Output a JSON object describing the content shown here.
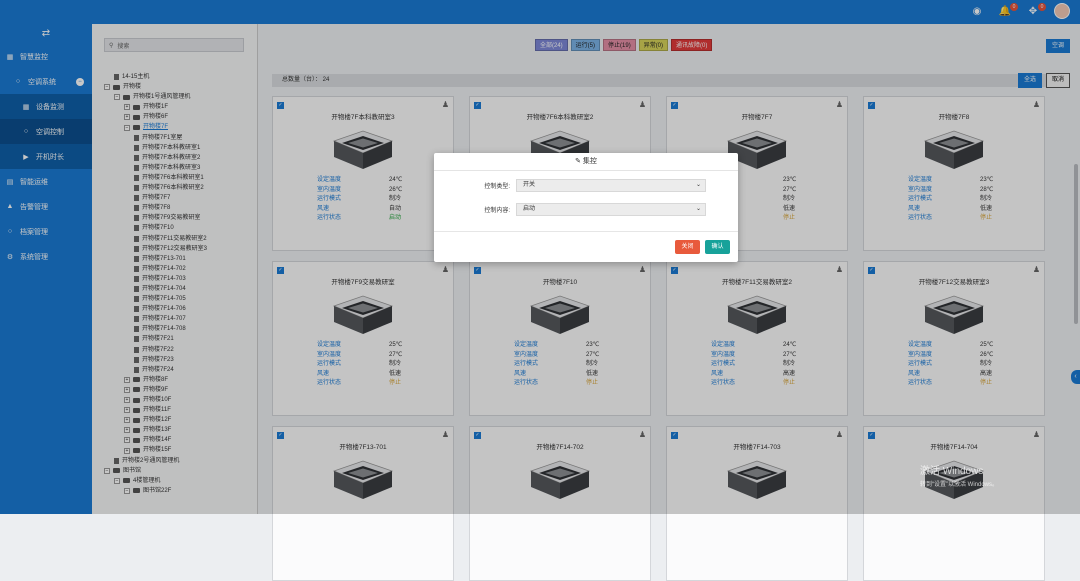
{
  "topbar": {
    "badges": {
      "bell": "0",
      "fullscreen": "0"
    },
    "icons": [
      "dashboard-icon",
      "bell-icon",
      "fullscreen-icon",
      "avatar"
    ]
  },
  "sidebar": {
    "items": [
      {
        "label": "智慧监控",
        "icon": "grid-icon",
        "level": 0
      },
      {
        "label": "空调系统",
        "icon": "circle-icon",
        "level": 1,
        "toggle": "−"
      },
      {
        "label": "设备监测",
        "icon": "grid-icon",
        "level": 2
      },
      {
        "label": "空调控制",
        "icon": "circle-icon",
        "level": 2,
        "active": true
      },
      {
        "label": "开机时长",
        "icon": "play-icon",
        "level": 2
      },
      {
        "label": "智能运维",
        "icon": "chart-icon",
        "level": 0
      },
      {
        "label": "告警管理",
        "icon": "bell-icon",
        "level": 0
      },
      {
        "label": "档案管理",
        "icon": "circle-icon",
        "level": 0
      },
      {
        "label": "系统管理",
        "icon": "gear-icon",
        "level": 0
      }
    ]
  },
  "tree": {
    "search_placeholder": "搜索",
    "nodes": [
      {
        "label": "14-15主机",
        "indent": 1,
        "type": "file"
      },
      {
        "label": "开物楼",
        "indent": 0,
        "type": "folder",
        "toggle": "−"
      },
      {
        "label": "开物楼1号通风管理机",
        "indent": 1,
        "type": "folder",
        "toggle": "−"
      },
      {
        "label": "开物楼1F",
        "indent": 2,
        "type": "folder",
        "toggle": "+"
      },
      {
        "label": "开物楼6F",
        "indent": 2,
        "type": "folder",
        "toggle": "+"
      },
      {
        "label": "开物楼7F",
        "indent": 2,
        "type": "folder",
        "toggle": "−",
        "highlight": true
      },
      {
        "label": "开物楼7F1室屋",
        "indent": 3,
        "type": "file"
      },
      {
        "label": "开物楼7F本科教研室1",
        "indent": 3,
        "type": "file"
      },
      {
        "label": "开物楼7F本科教研室2",
        "indent": 3,
        "type": "file"
      },
      {
        "label": "开物楼7F本科教研室3",
        "indent": 3,
        "type": "file"
      },
      {
        "label": "开物楼7F6本科教研室1",
        "indent": 3,
        "type": "file"
      },
      {
        "label": "开物楼7F6本科教研室2",
        "indent": 3,
        "type": "file"
      },
      {
        "label": "开物楼7F7",
        "indent": 3,
        "type": "file"
      },
      {
        "label": "开物楼7F8",
        "indent": 3,
        "type": "file"
      },
      {
        "label": "开物楼7F9交易教研室",
        "indent": 3,
        "type": "file"
      },
      {
        "label": "开物楼7F10",
        "indent": 3,
        "type": "file"
      },
      {
        "label": "开物楼7F11交易教研室2",
        "indent": 3,
        "type": "file"
      },
      {
        "label": "开物楼7F12交易教研室3",
        "indent": 3,
        "type": "file"
      },
      {
        "label": "开物楼7F13-701",
        "indent": 3,
        "type": "file"
      },
      {
        "label": "开物楼7F14-702",
        "indent": 3,
        "type": "file"
      },
      {
        "label": "开物楼7F14-703",
        "indent": 3,
        "type": "file"
      },
      {
        "label": "开物楼7F14-704",
        "indent": 3,
        "type": "file"
      },
      {
        "label": "开物楼7F14-705",
        "indent": 3,
        "type": "file"
      },
      {
        "label": "开物楼7F14-706",
        "indent": 3,
        "type": "file"
      },
      {
        "label": "开物楼7F14-707",
        "indent": 3,
        "type": "file"
      },
      {
        "label": "开物楼7F14-708",
        "indent": 3,
        "type": "file"
      },
      {
        "label": "开物楼7F21",
        "indent": 3,
        "type": "file"
      },
      {
        "label": "开物楼7F22",
        "indent": 3,
        "type": "file"
      },
      {
        "label": "开物楼7F23",
        "indent": 3,
        "type": "file"
      },
      {
        "label": "开物楼7F24",
        "indent": 3,
        "type": "file"
      },
      {
        "label": "开物楼8F",
        "indent": 2,
        "type": "folder",
        "toggle": "+"
      },
      {
        "label": "开物楼9F",
        "indent": 2,
        "type": "folder",
        "toggle": "+"
      },
      {
        "label": "开物楼10F",
        "indent": 2,
        "type": "folder",
        "toggle": "+"
      },
      {
        "label": "开物楼11F",
        "indent": 2,
        "type": "folder",
        "toggle": "+"
      },
      {
        "label": "开物楼12F",
        "indent": 2,
        "type": "folder",
        "toggle": "+"
      },
      {
        "label": "开物楼13F",
        "indent": 2,
        "type": "folder",
        "toggle": "+"
      },
      {
        "label": "开物楼14F",
        "indent": 2,
        "type": "folder",
        "toggle": "+"
      },
      {
        "label": "开物楼15F",
        "indent": 2,
        "type": "folder",
        "toggle": "+"
      },
      {
        "label": "开物楼2号通风管理机",
        "indent": 1,
        "type": "file"
      },
      {
        "label": "图书馆",
        "indent": 0,
        "type": "folder",
        "toggle": "−"
      },
      {
        "label": "4楼管理机",
        "indent": 1,
        "type": "folder",
        "toggle": "−"
      },
      {
        "label": "图书馆22F",
        "indent": 2,
        "type": "folder",
        "toggle": "−"
      }
    ]
  },
  "filters": [
    {
      "label": "全部(24)",
      "cls": "f-all"
    },
    {
      "label": "运行(5)",
      "cls": "f-run"
    },
    {
      "label": "停止(19)",
      "cls": "f-stop"
    },
    {
      "label": "异常(0)",
      "cls": "f-abn"
    },
    {
      "label": "通讯故障(0)",
      "cls": "f-brk"
    }
  ],
  "buttons": {
    "config": "空调",
    "select_all": "全选",
    "cancel": "取消"
  },
  "total": {
    "label": "总数量（台）： 24"
  },
  "prop_labels": [
    "设定温度",
    "室内温度",
    "运行模式",
    "风速",
    "运行状态"
  ],
  "cards": [
    {
      "title": "开物楼7F本科教研室3",
      "values": [
        "24℃",
        "26℃",
        "制冷",
        "自动",
        "启动"
      ],
      "status": "on"
    },
    {
      "title": "开物楼7F6本科教研室2",
      "values": [
        "",
        "",
        "",
        "",
        ""
      ],
      "status": "off"
    },
    {
      "title": "开物楼7F7",
      "values": [
        "23℃",
        "27℃",
        "制冷",
        "低速",
        "停止"
      ],
      "status": "off"
    },
    {
      "title": "开物楼7F8",
      "values": [
        "23℃",
        "28℃",
        "制冷",
        "低速",
        "停止"
      ],
      "status": "off"
    },
    {
      "title": "开物楼7F9交易教研室",
      "values": [
        "25℃",
        "27℃",
        "制冷",
        "低速",
        "停止"
      ],
      "status": "off"
    },
    {
      "title": "开物楼7F10",
      "values": [
        "23℃",
        "27℃",
        "制冷",
        "低速",
        "停止"
      ],
      "status": "off"
    },
    {
      "title": "开物楼7F11交易教研室2",
      "values": [
        "24℃",
        "27℃",
        "制冷",
        "高速",
        "停止"
      ],
      "status": "off"
    },
    {
      "title": "开物楼7F12交易教研室3",
      "values": [
        "25℃",
        "26℃",
        "制冷",
        "高速",
        "停止"
      ],
      "status": "off"
    },
    {
      "title": "开物楼7F13-701",
      "values": [
        "",
        "",
        "",
        "",
        ""
      ],
      "status": "off"
    },
    {
      "title": "开物楼7F14-702",
      "values": [
        "",
        "",
        "",
        "",
        ""
      ],
      "status": "off"
    },
    {
      "title": "开物楼7F14-703",
      "values": [
        "",
        "",
        "",
        "",
        ""
      ],
      "status": "off"
    },
    {
      "title": "开物楼7F14-704",
      "values": [
        "",
        "",
        "",
        "",
        ""
      ],
      "status": "off"
    }
  ],
  "modal": {
    "title": "集控",
    "type_label": "控制类型:",
    "type_value": "开关",
    "content_label": "控制内容:",
    "content_value": "启动",
    "close": "关闭",
    "ok": "确认"
  },
  "watermark": {
    "line1": "激活 Windows",
    "line2": "转到“设置”以激活 Windows。"
  }
}
